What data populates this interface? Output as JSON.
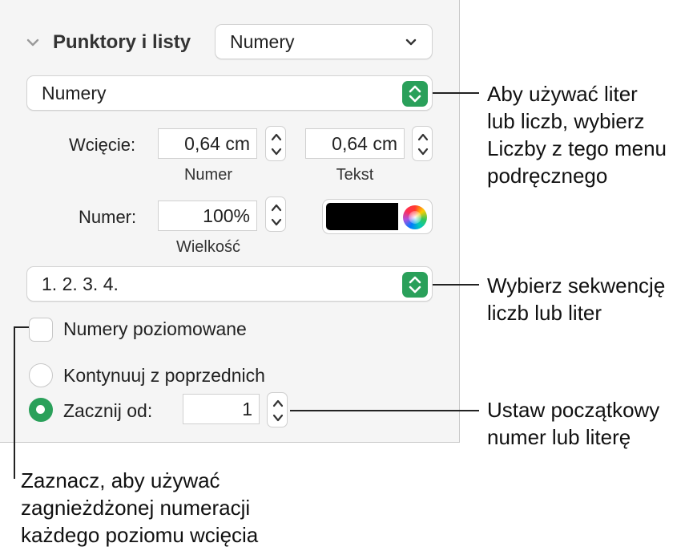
{
  "panel": {
    "section_title": "Punktory i listy",
    "bullet_style_popup": "Numery",
    "list_type_select": "Numery",
    "indent_label": "Wcięcie:",
    "number_indent_value": "0,64 cm",
    "number_indent_caption": "Numer",
    "text_indent_value": "0,64 cm",
    "text_indent_caption": "Tekst",
    "number_label": "Numer:",
    "size_value": "100%",
    "size_caption": "Wielkość",
    "color_value": "#000000",
    "sequence_select": "1. 2. 3. 4.",
    "tiered_checkbox_label": "Numery poziomowane",
    "tiered_checked": false,
    "continue_radio_label": "Kontynuuj z poprzednich",
    "start_radio_label": "Zacznij od:",
    "start_value": "1",
    "selected_radio": "start"
  },
  "callouts": {
    "letters_numbers": [
      "Aby używać liter",
      "lub liczb, wybierz",
      "Liczby z tego menu",
      "podręcznego"
    ],
    "sequence": [
      "Wybierz sekwencję",
      "liczb lub liter"
    ],
    "start_number": [
      "Ustaw początkowy",
      "numer lub literę"
    ],
    "tiered": [
      "Zaznacz, aby używać",
      "zagnieżdżonej numeracji",
      "każdego poziomu wcięcia"
    ]
  },
  "colors": {
    "accent": "#2aa05a",
    "panel_bg": "#f5f5f5"
  }
}
